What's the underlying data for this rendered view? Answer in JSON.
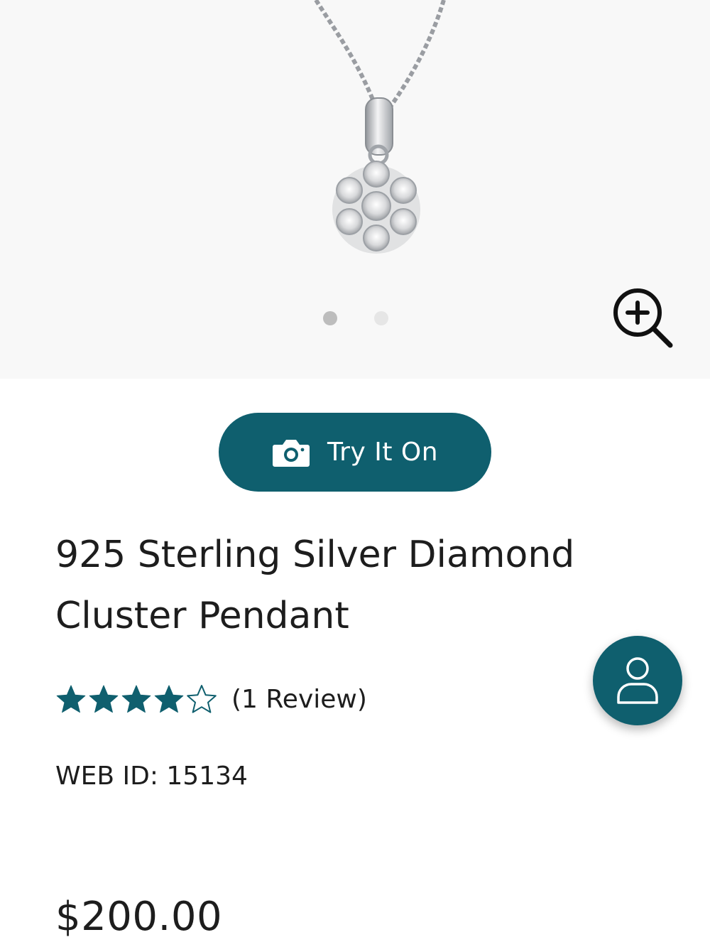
{
  "gallery": {
    "image_alt": "925 Sterling Silver Diamond Cluster Pendant",
    "slide_count": 2,
    "active_slide": 1,
    "zoom_icon": "zoom-in-icon"
  },
  "try_on": {
    "label": "Try It On",
    "icon": "camera-icon"
  },
  "product": {
    "title_line1": "925 Sterling Silver Diamond",
    "title_line2": "Cluster Pendant",
    "rating": 4,
    "rating_max": 5,
    "review_count_text": "(1 Review)",
    "web_id": "WEB ID: 15134",
    "price": "$200.00"
  },
  "account_fab": {
    "icon": "user-icon"
  },
  "colors": {
    "brand": "#0f5f6e",
    "text": "#1d1d1d",
    "gallery_bg": "#f8f8f8"
  }
}
